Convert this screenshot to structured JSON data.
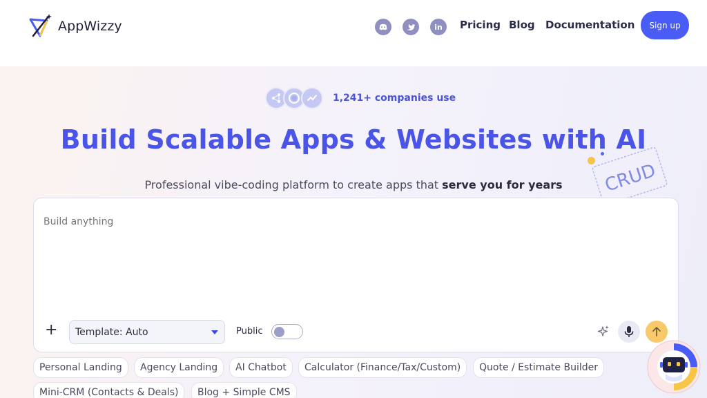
{
  "header": {
    "logo_text": "AppWizzy",
    "social": [
      {
        "name": "discord-icon"
      },
      {
        "name": "twitter-icon"
      },
      {
        "name": "linkedin-icon",
        "glyph": "in"
      }
    ],
    "nav": [
      "Pricing",
      "Blog",
      "Documentation"
    ],
    "signup_label": "Sign up"
  },
  "hero": {
    "companies_text": "1,241+ companies use",
    "title": "Build Scalable Apps & Websites with AI",
    "subtitle_lead": "Professional vibe-coding platform to create apps that ",
    "subtitle_bold": "serve you for years",
    "sticker_text": "CRUD"
  },
  "prompt": {
    "placeholder": "Build anything",
    "template_label": "Template: Auto",
    "public_label": "Public",
    "public_on": false
  },
  "chips": [
    "Personal Landing",
    "Agency Landing",
    "AI Chatbot",
    "Calculator (Finance/Tax/Custom)",
    "Quote / Estimate Builder",
    "Mini-CRM (Contacts & Deals)",
    "Blog + Simple CMS"
  ],
  "colors": {
    "accent": "#4a5cf6",
    "title": "#4a54e6",
    "send": "#f7c96b"
  }
}
